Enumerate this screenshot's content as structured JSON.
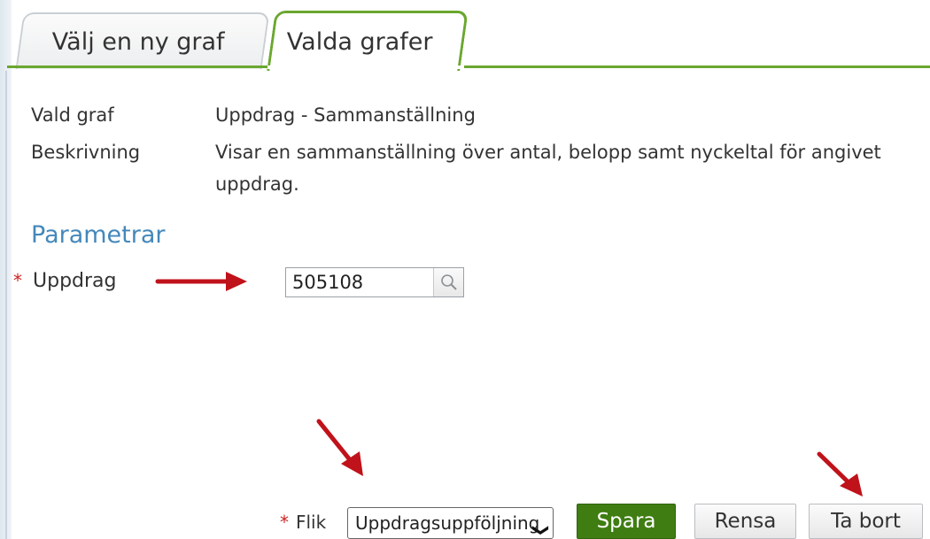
{
  "tabs": [
    {
      "label": "Välj en ny graf",
      "active": false
    },
    {
      "label": "Valda grafer",
      "active": true
    }
  ],
  "info": {
    "selected_graph_label": "Vald graf",
    "selected_graph_value": "Uppdrag - Sammanställning",
    "description_label": "Beskrivning",
    "description_value": "Visar en sammanställning över antal, belopp samt nyckeltal för angivet uppdrag."
  },
  "parameters": {
    "title": "Parametrar",
    "required_marker": "*",
    "uppdrag_label": "Uppdrag",
    "uppdrag_value": "505108",
    "lookup_icon": "search-icon"
  },
  "footer": {
    "required_marker": "*",
    "flik_label": "Flik",
    "flik_selected": "Uppdragsuppföljning",
    "save_label": "Spara",
    "clear_label": "Rensa",
    "delete_label": "Ta bort"
  },
  "colors": {
    "accent_green": "#6aa72f",
    "save_button": "#3f7d12",
    "section_title": "#4488bb",
    "required": "#cc2222",
    "annotation_arrow": "#c0121a"
  }
}
